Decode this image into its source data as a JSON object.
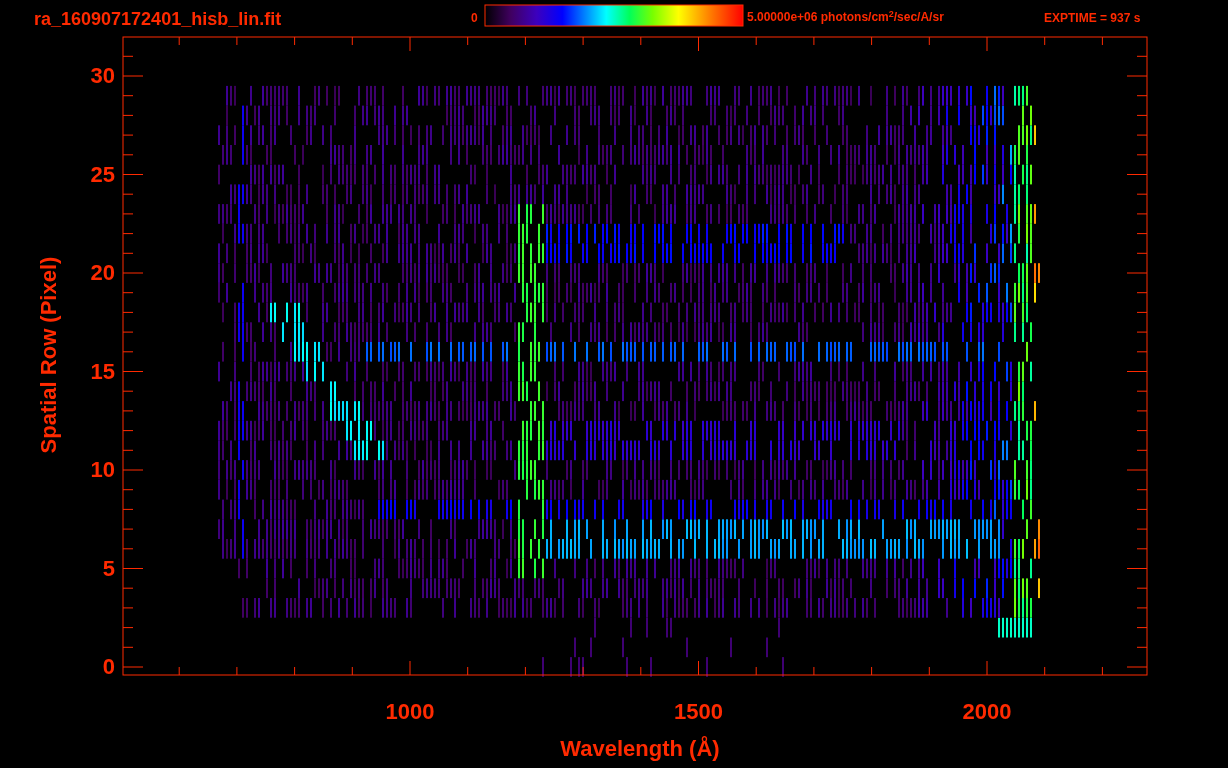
{
  "window": {
    "title": "ra_160907172401_hisb_lin.fit"
  },
  "colorbar": {
    "min_label": "0",
    "max_label": "5.00000e+06 photons/cm$^{2}$/sec/A/sr"
  },
  "exposure": "EXPTIME = 937 s",
  "plot": {
    "xlabel": "Wavelength (Å)",
    "ylabel": "Spatial Row (Pixel)",
    "xticks": [
      "1000",
      "1500",
      "2000"
    ],
    "yticks": [
      "30",
      "25",
      "20",
      "15",
      "10",
      "5",
      "0"
    ]
  }
}
